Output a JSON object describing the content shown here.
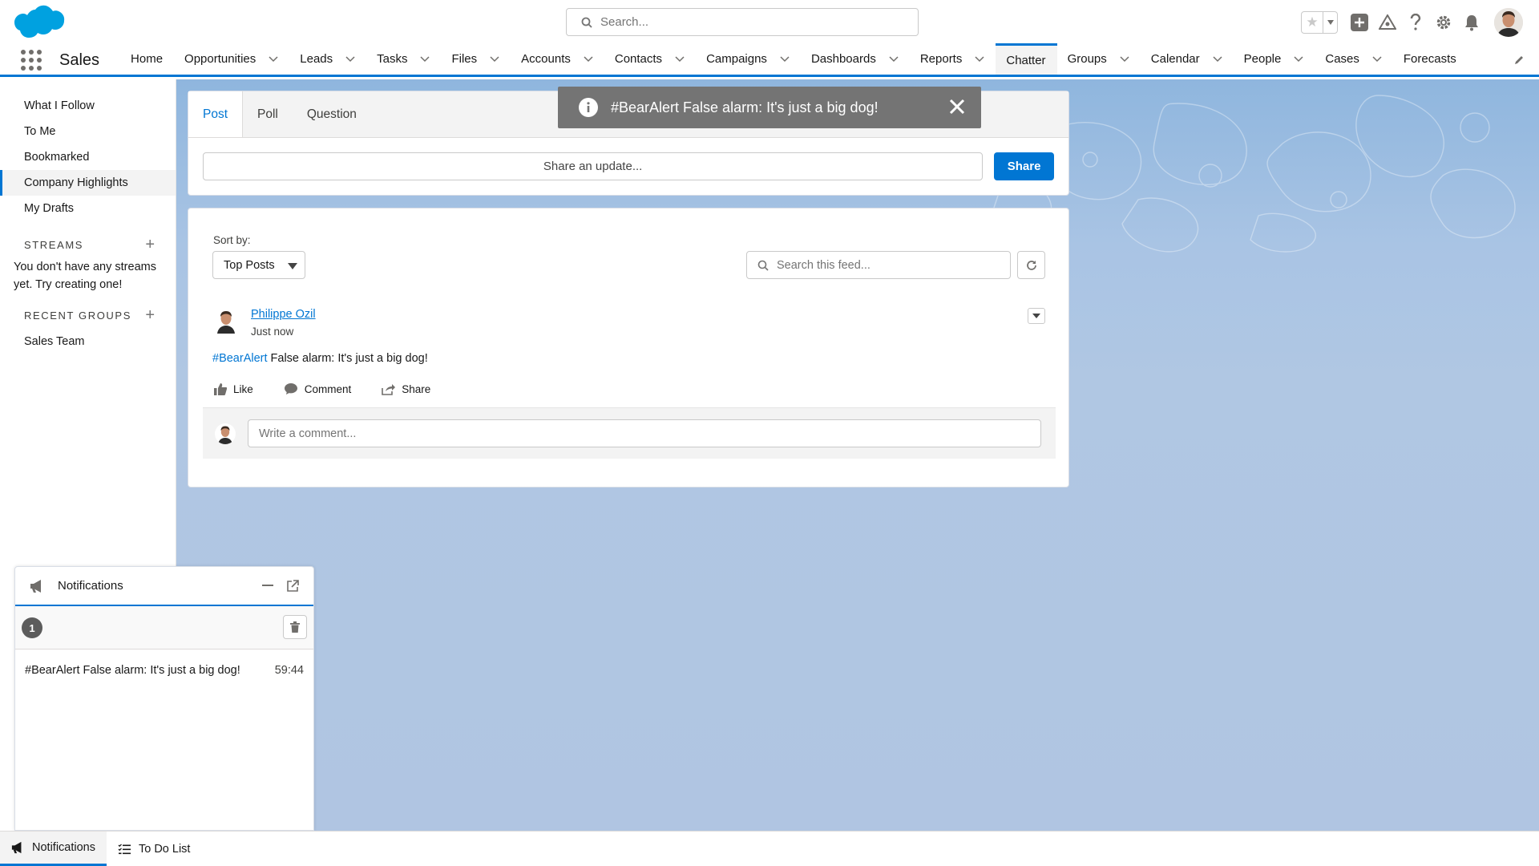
{
  "header": {
    "search_placeholder": "Search..."
  },
  "nav": {
    "app_name": "Sales",
    "items": [
      {
        "label": "Home",
        "has_menu": false
      },
      {
        "label": "Opportunities",
        "has_menu": true
      },
      {
        "label": "Leads",
        "has_menu": true
      },
      {
        "label": "Tasks",
        "has_menu": true
      },
      {
        "label": "Files",
        "has_menu": true
      },
      {
        "label": "Accounts",
        "has_menu": true
      },
      {
        "label": "Contacts",
        "has_menu": true
      },
      {
        "label": "Campaigns",
        "has_menu": true
      },
      {
        "label": "Dashboards",
        "has_menu": true
      },
      {
        "label": "Reports",
        "has_menu": true
      },
      {
        "label": "Chatter",
        "has_menu": false,
        "active": true
      },
      {
        "label": "Groups",
        "has_menu": true
      },
      {
        "label": "Calendar",
        "has_menu": true
      },
      {
        "label": "People",
        "has_menu": true
      },
      {
        "label": "Cases",
        "has_menu": true
      },
      {
        "label": "Forecasts",
        "has_menu": false
      }
    ]
  },
  "sidebar": {
    "links": [
      "What I Follow",
      "To Me",
      "Bookmarked",
      "Company Highlights",
      "My Drafts"
    ],
    "active_link": "Company Highlights",
    "streams_heading": "STREAMS",
    "streams_empty": "You don't have any streams yet. Try creating one!",
    "recent_groups_heading": "RECENT GROUPS",
    "groups": [
      "Sales Team"
    ]
  },
  "publisher": {
    "tabs": [
      "Post",
      "Poll",
      "Question"
    ],
    "active_tab": "Post",
    "share_placeholder": "Share an update...",
    "share_button": "Share"
  },
  "toast": {
    "message": "#BearAlert False alarm: It's just a big dog!"
  },
  "feed": {
    "sort_label": "Sort by:",
    "sort_value": "Top Posts",
    "search_placeholder": "Search this feed...",
    "post": {
      "author": "Philippe Ozil",
      "time": "Just now",
      "hashtag": "#BearAlert",
      "text": " False alarm: It's just a big dog!",
      "actions": {
        "like": "Like",
        "comment": "Comment",
        "share": "Share"
      },
      "comment_placeholder": "Write a comment..."
    }
  },
  "notifications_panel": {
    "title": "Notifications",
    "count": "1",
    "item_text": "#BearAlert False alarm: It's just a big dog!",
    "item_time": "59:44"
  },
  "utility_bar": {
    "items": [
      "Notifications",
      "To Do List"
    ],
    "active_item": "Notifications"
  },
  "colors": {
    "brand": "#0176d3",
    "toast_bg": "#747474",
    "background": "#b0c5e2"
  }
}
